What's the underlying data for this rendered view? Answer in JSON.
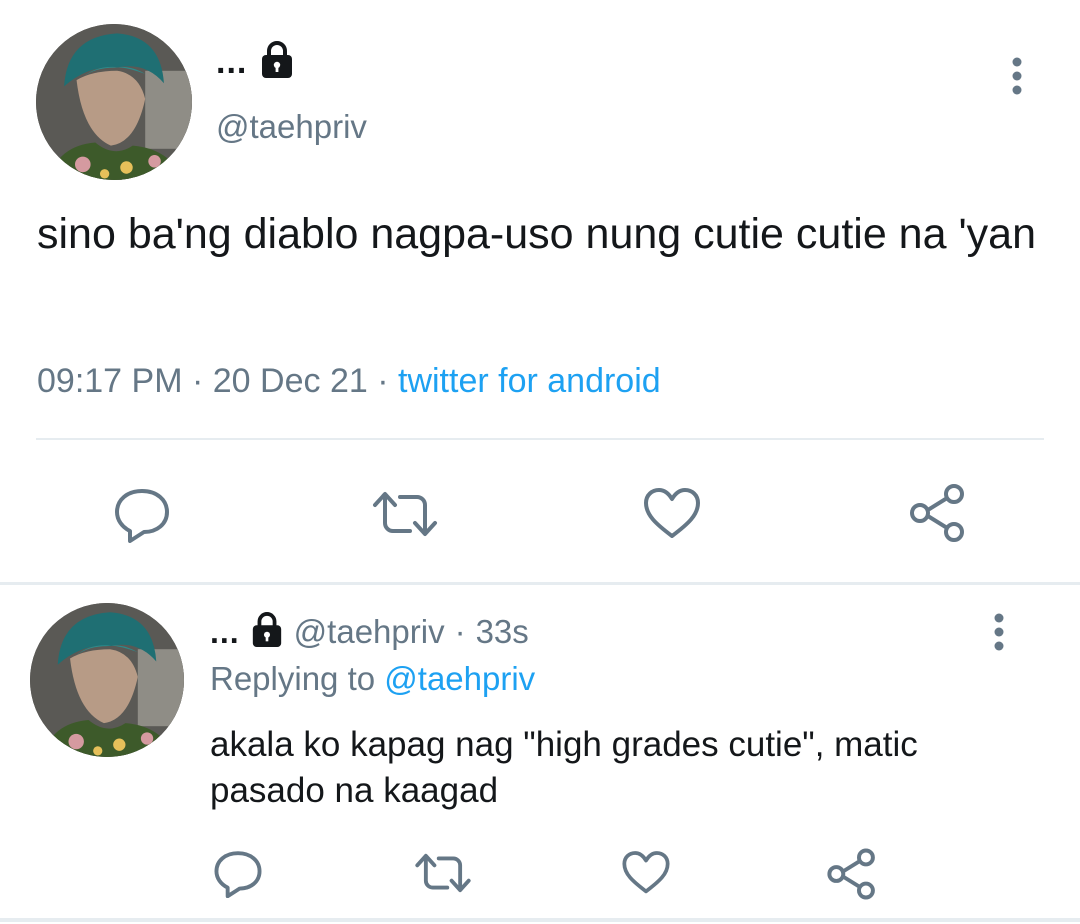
{
  "colors": {
    "primary_text": "#14171a",
    "secondary_text": "#657786",
    "link": "#1da1f2",
    "divider": "#e6ecf0",
    "icon": "#657786"
  },
  "main_tweet": {
    "display_name": "...",
    "name_icon": "lock-icon",
    "handle": "@taehpriv",
    "text": "sino ba'ng diablo nagpa-uso nung cutie cutie na 'yan",
    "time": "09:17 PM",
    "sep1": "·",
    "date": "20 Dec 21",
    "sep2": "·",
    "source": "twitter for android",
    "actions": [
      "reply-icon",
      "retweet-icon",
      "like-icon",
      "share-icon"
    ]
  },
  "reply_tweet": {
    "display_name": "...",
    "name_icon": "lock-icon",
    "handle": "@taehpriv",
    "sep": "·",
    "age": "33s",
    "replying_label": "Replying to",
    "replying_handle": "@taehpriv",
    "text": "akala ko kapag nag \"high grades cutie\", matic pasado na kaagad",
    "actions": [
      "reply-icon",
      "retweet-icon",
      "like-icon",
      "share-icon"
    ]
  }
}
